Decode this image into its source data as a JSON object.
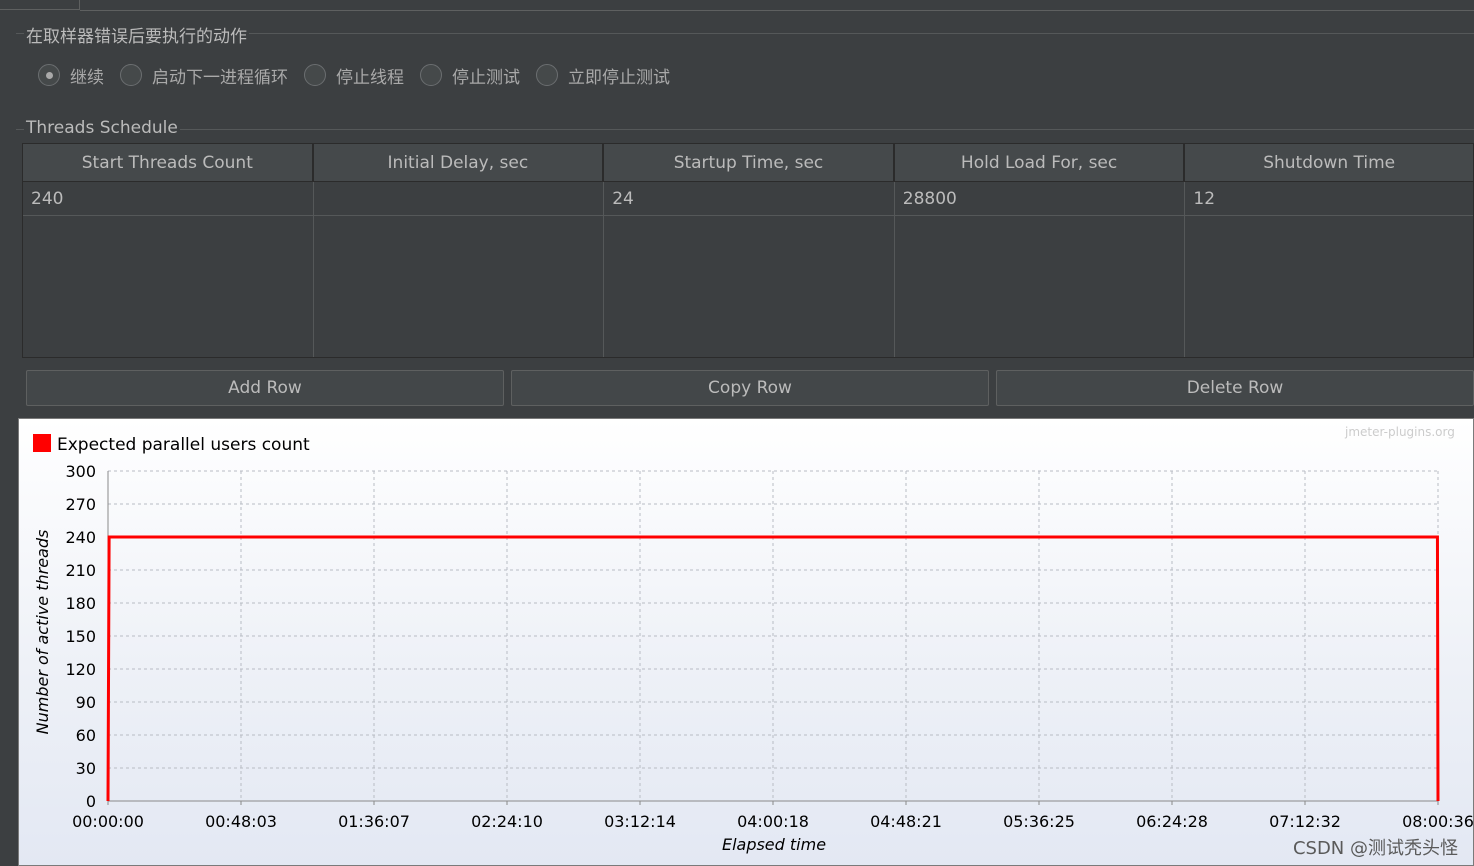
{
  "on_error": {
    "title": "在取样器错误后要执行的动作",
    "options": [
      {
        "label": "继续",
        "checked": true
      },
      {
        "label": "启动下一进程循环",
        "checked": false
      },
      {
        "label": "停止线程",
        "checked": false
      },
      {
        "label": "停止测试",
        "checked": false
      },
      {
        "label": "立即停止测试",
        "checked": false
      }
    ]
  },
  "schedule": {
    "title": "Threads Schedule",
    "columns": [
      "Start Threads Count",
      "Initial Delay, sec",
      "Startup Time, sec",
      "Hold Load For, sec",
      "Shutdown Time"
    ],
    "rows": [
      [
        "240",
        "",
        "24",
        "28800",
        "12"
      ]
    ]
  },
  "buttons": {
    "add": "Add Row",
    "copy": "Copy Row",
    "delete": "Delete Row"
  },
  "chart_data": {
    "type": "line",
    "legend": "Expected parallel users count",
    "series_color": "#ff0000",
    "credit": "jmeter-plugins.org",
    "xlabel": "Elapsed time",
    "ylabel": "Number of active threads",
    "ylim": [
      0,
      300
    ],
    "yticks": [
      0,
      30,
      60,
      90,
      120,
      150,
      180,
      210,
      240,
      270,
      300
    ],
    "xlim_seconds": [
      0,
      28836
    ],
    "xticks": [
      "00:00:00",
      "00:48:03",
      "01:36:07",
      "02:24:10",
      "03:12:14",
      "04:00:18",
      "04:48:21",
      "05:36:25",
      "06:24:28",
      "07:12:32",
      "08:00:36"
    ],
    "series": [
      {
        "name": "Expected parallel users count",
        "x": [
          "00:00:00",
          "00:00:24",
          "08:00:24",
          "08:00:36"
        ],
        "y": [
          0,
          240,
          240,
          0
        ]
      }
    ],
    "grid": true
  },
  "watermark": "CSDN @测试秃头怪"
}
